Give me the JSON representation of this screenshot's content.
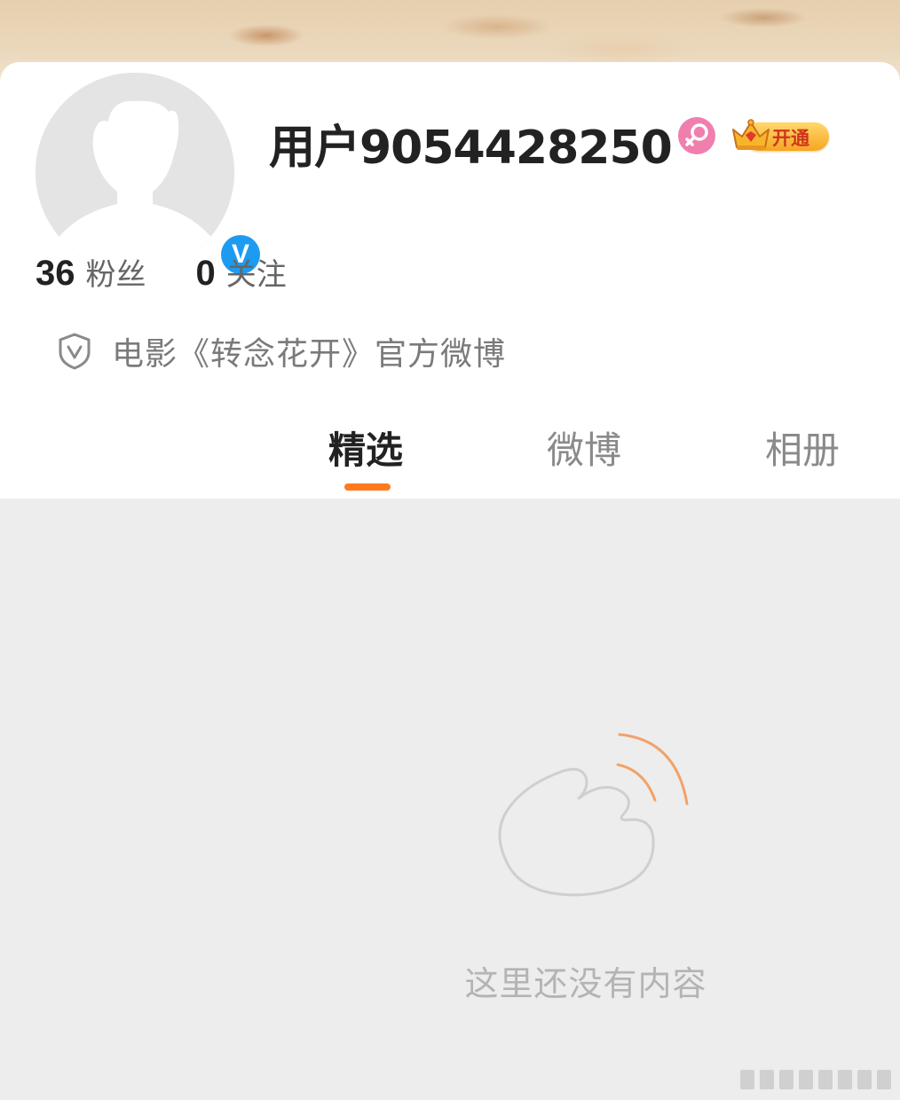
{
  "profile": {
    "username": "用户9054428250",
    "vip_label": "开通",
    "followers_count": "36",
    "followers_label": "粉丝",
    "following_count": "0",
    "following_label": "关注",
    "verification_text": "电影《转念花开》官方微博",
    "verified_badge": "V"
  },
  "tabs": [
    {
      "label": "精选",
      "active": true
    },
    {
      "label": "微博",
      "active": false
    },
    {
      "label": "相册",
      "active": false
    }
  ],
  "empty_state": {
    "message": "这里还没有内容"
  },
  "colors": {
    "accent": "#ff7a1c",
    "verified_blue": "#1d9bf0",
    "gender_pink": "#f07fae",
    "background": "#ededed"
  },
  "icons": [
    "avatar-placeholder-icon",
    "verified-icon",
    "female-icon",
    "crown-icon",
    "shield-v-icon",
    "empty-hand-icon"
  ]
}
